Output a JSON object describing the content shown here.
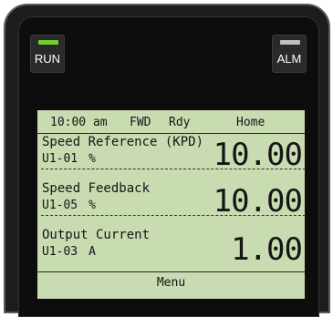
{
  "indicators": {
    "run": {
      "label": "RUN",
      "led_color": "#6fd32f"
    },
    "alm": {
      "label": "ALM",
      "led_color": "#bfbfbf"
    }
  },
  "status": {
    "time": "10:00 am",
    "direction": "FWD",
    "state": "Rdy",
    "mode": "Home"
  },
  "monitors": [
    {
      "label": "Speed Reference (KPD)",
      "param": "U1-01",
      "unit": "%",
      "value": "10.00"
    },
    {
      "label": "Speed Feedback",
      "param": "U1-05",
      "unit": "%",
      "value": "10.00"
    },
    {
      "label": "Output Current",
      "param": "U1-03",
      "unit": "A",
      "value": "1.00"
    }
  ],
  "menu": {
    "label": "Menu"
  },
  "colors": {
    "lcd_background": "#c9dbb1",
    "bezel": "#1d1d1d"
  }
}
